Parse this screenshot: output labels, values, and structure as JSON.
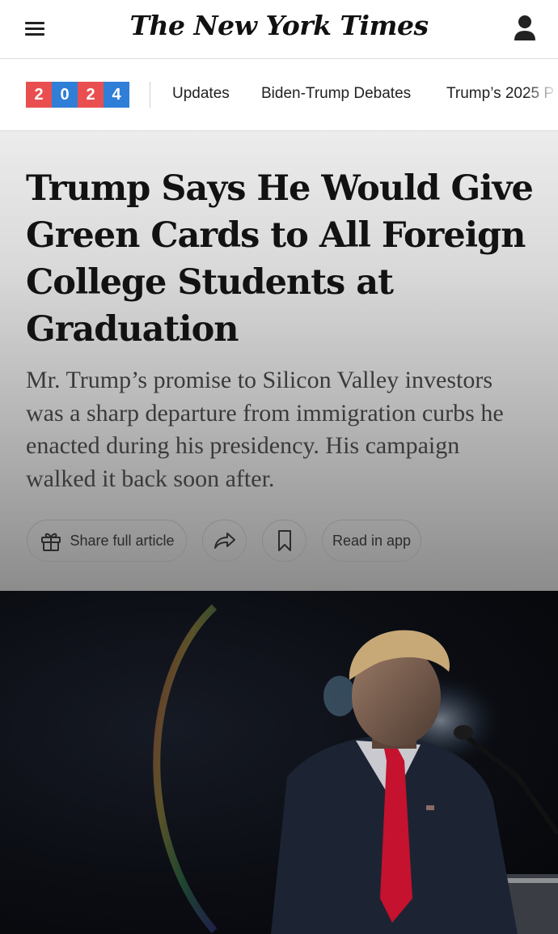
{
  "header": {
    "menu_icon": "hamburger-menu-icon",
    "logo_text": "The New York Times",
    "account_icon": "person-icon"
  },
  "nav": {
    "year_badge": {
      "digits": [
        "2",
        "0",
        "2",
        "4"
      ],
      "colors": [
        "#e94f4f",
        "#2f7ed8",
        "#e94f4f",
        "#2f7ed8"
      ]
    },
    "links": [
      "Updates",
      "Biden-Trump Debates",
      "Trump’s 2025 P"
    ]
  },
  "article": {
    "headline": "Trump Says He Would Give Green Cards to All Foreign College Students at Graduation",
    "summary": "Mr. Trump’s promise to Silicon Valley investors was a sharp departure from immigration curbs he enacted during his presidency. His campaign walked it back soon after.",
    "actions": {
      "share_label": "Share full article",
      "share_icon": "gift-icon",
      "forward_icon": "share-arrow-icon",
      "bookmark_icon": "bookmark-icon",
      "read_in_app_label": "Read in app"
    }
  },
  "colors": {
    "hero_top": "#ececec",
    "hero_bottom": "#8c8c8c",
    "tie": "#c4122f",
    "suit": "#1c2433"
  }
}
